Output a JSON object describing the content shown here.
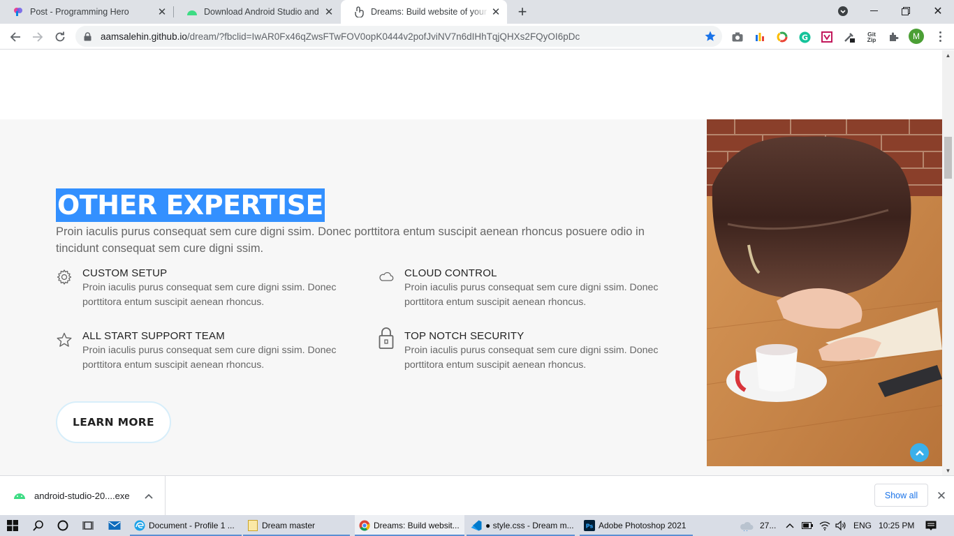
{
  "browser": {
    "tabs": [
      {
        "title": "Post - Programming Hero"
      },
      {
        "title": "Download Android Studio and SDK tools"
      },
      {
        "title": "Dreams: Build website of your dreams"
      }
    ],
    "new_tab": "+",
    "url_host": "aamsalehin.github.io",
    "url_rest": "/dream/?fbclid=IwAR0Fx46qZwsFTwFOV0opK0444v2pofJviNV7n6dIHhTqjQHXs2FQyOI6pDc",
    "profile_initial": "M",
    "gitzip_label": "Git Zip"
  },
  "page": {
    "heading": "OTHER EXPERTISE",
    "lead": "Proin iaculis purus consequat sem cure digni ssim. Donec porttitora entum suscipit aenean rhoncus posuere odio in tincidunt consequat sem cure digni ssim.",
    "features": [
      {
        "title": "CUSTOM SETUP",
        "icon": "gear-icon",
        "desc": "Proin iaculis purus consequat sem cure digni ssim. Donec porttitora entum suscipit aenean rhoncus."
      },
      {
        "title": "CLOUD CONTROL",
        "icon": "cloud-icon",
        "desc": "Proin iaculis purus consequat sem cure digni ssim. Donec porttitora entum suscipit aenean rhoncus."
      },
      {
        "title": "ALL START SUPPORT TEAM",
        "icon": "star-icon",
        "desc": "Proin iaculis purus consequat sem cure digni ssim. Donec porttitora entum suscipit aenean rhoncus."
      },
      {
        "title": "TOP NOTCH SECURITY",
        "icon": "lock-icon",
        "desc": "Proin iaculis purus consequat sem cure digni ssim. Donec porttitora entum suscipit aenean rhoncus."
      }
    ],
    "cta": "LEARN MORE"
  },
  "downloads": {
    "file": "android-studio-20....exe",
    "show_all": "Show all"
  },
  "taskbar": {
    "apps": [
      {
        "label": "Document - Profile 1 ..."
      },
      {
        "label": "Dream master"
      },
      {
        "label": "Dreams: Build websit..."
      },
      {
        "label": "● style.css - Dream m..."
      },
      {
        "label": "Adobe Photoshop 2021"
      }
    ],
    "weather": "27...",
    "lang": "ENG",
    "time": "10:25 PM"
  },
  "colors": {
    "highlight": "#3390ff",
    "accent": "#3ab0ea",
    "section_bg": "#f7f7f7"
  }
}
